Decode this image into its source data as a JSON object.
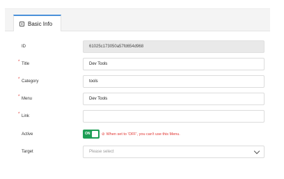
{
  "tabs": [
    {
      "label": "Basic Info",
      "icon": "info-card-icon"
    }
  ],
  "form": {
    "id": {
      "label": "ID",
      "value": "61025c173050a57fd654d968"
    },
    "title": {
      "label": "Title",
      "value": "Dev Tools",
      "required": true
    },
    "category": {
      "label": "Category",
      "value": "tools",
      "required": true
    },
    "menu": {
      "label": "Menu",
      "value": "Dev Tools",
      "required": true
    },
    "link": {
      "label": "Link",
      "value": "",
      "required": true
    },
    "active": {
      "label": "Active",
      "toggle_text": "ON",
      "state": true,
      "hint": "When set to 'OFF', you can't use this Menu."
    },
    "target": {
      "label": "Target",
      "placeholder": "Please select"
    }
  },
  "required_mark": "*",
  "colors": {
    "accent": "#4a90d9",
    "toggle_on": "#1e9e55",
    "error": "#e0332f"
  }
}
